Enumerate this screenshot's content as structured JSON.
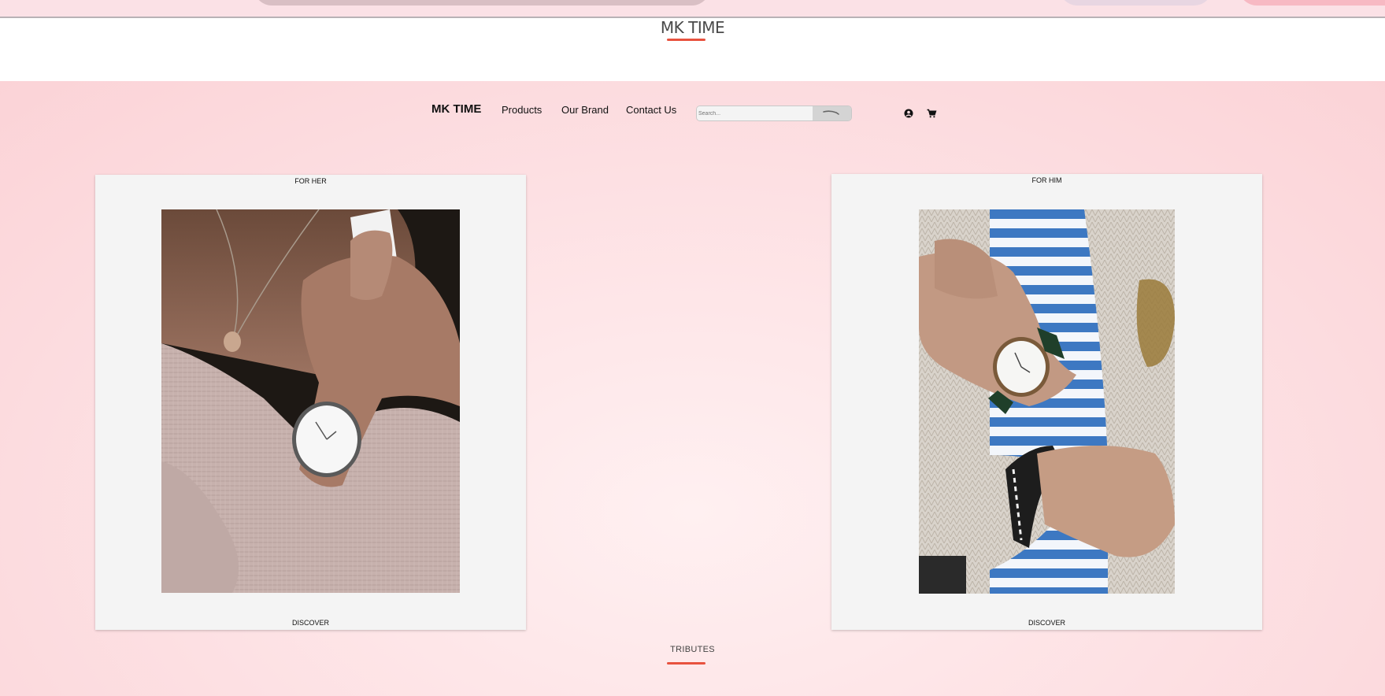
{
  "header": {
    "title": "MK TIME"
  },
  "nav": {
    "brand": "MK TIME",
    "links": [
      "Products",
      "Our Brand",
      "Contact Us"
    ],
    "search_placeholder": "Search..."
  },
  "cards": [
    {
      "top_label": "FOR HER",
      "bottom_label": "DISCOVER"
    },
    {
      "top_label": "FOR HIM",
      "bottom_label": "DISCOVER"
    }
  ],
  "tributes": {
    "title": "TRIBUTES"
  },
  "colors": {
    "accent": "#e8523f",
    "background": "#fde0e3",
    "card": "#f4f4f4"
  },
  "icons": [
    "search-icon",
    "account-icon",
    "cart-icon"
  ]
}
